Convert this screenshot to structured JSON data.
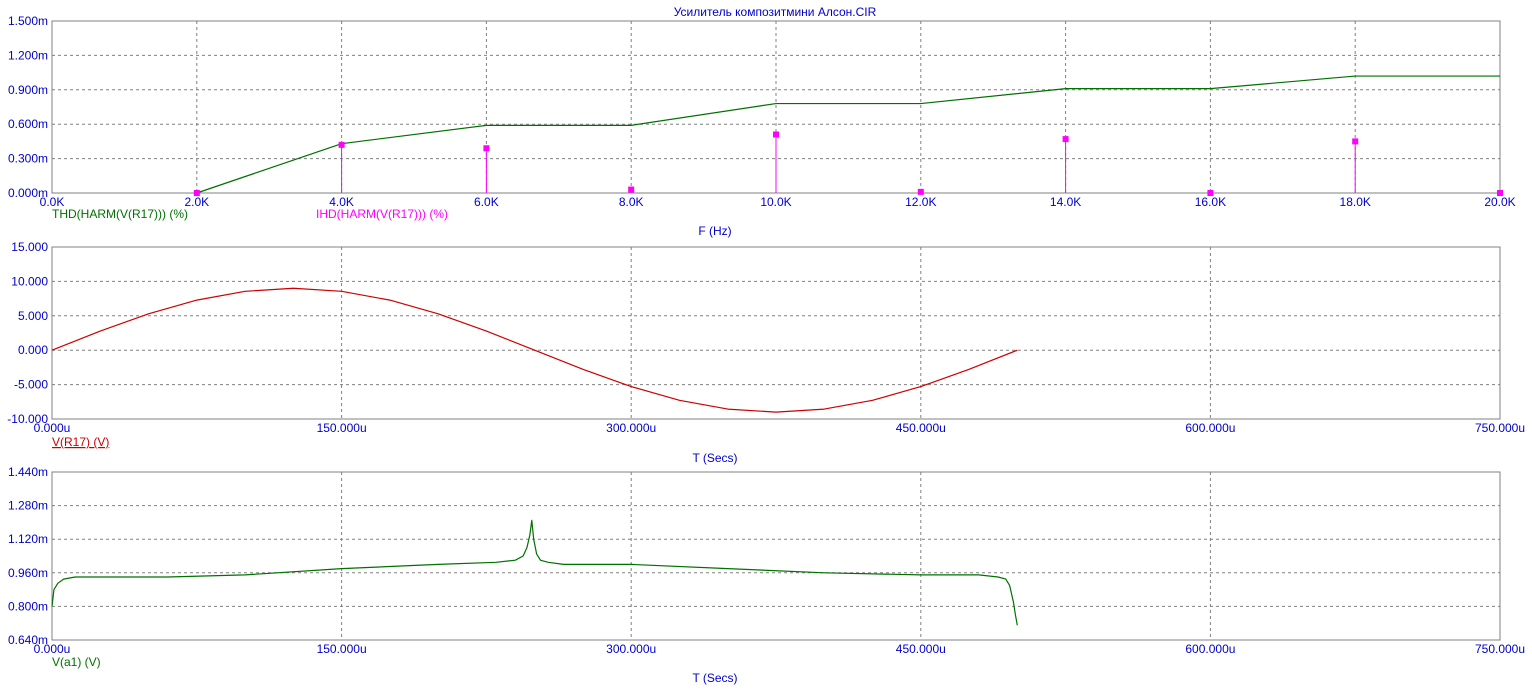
{
  "title": "Усилитель  композитмини Алсон.CIR",
  "colors": {
    "axis_text": "#0000cc",
    "grid": "#808080",
    "frame": "#808080",
    "thd": "#007000",
    "ihd": "#ff00ff",
    "vr17": "#cc0000",
    "va1": "#007000"
  },
  "chart_data": [
    {
      "type": "line",
      "xlabel": "F (Hz)",
      "xlim": [
        0,
        20000
      ],
      "ylim": [
        0,
        1.5
      ],
      "x_ticks": [
        "0.0K",
        "2.0K",
        "4.0K",
        "6.0K",
        "8.0K",
        "10.0K",
        "12.0K",
        "14.0K",
        "16.0K",
        "18.0K",
        "20.0K"
      ],
      "y_ticks": [
        "0.000m",
        "0.300m",
        "0.600m",
        "0.900m",
        "1.200m",
        "1.500m"
      ],
      "grid": true,
      "series": [
        {
          "name": "THD(HARM(V(R17))) (%)",
          "style": "line",
          "x": [
            2000,
            4000,
            6000,
            8000,
            10000,
            12000,
            14000,
            16000,
            18000,
            20000
          ],
          "y": [
            0.0,
            0.43,
            0.59,
            0.59,
            0.78,
            0.78,
            0.91,
            0.91,
            1.02,
            1.02
          ]
        },
        {
          "name": "IHD(HARM(V(R17))) (%)",
          "style": "stem",
          "x": [
            2000,
            4000,
            6000,
            8000,
            10000,
            12000,
            14000,
            16000,
            18000,
            20000
          ],
          "y": [
            0.0,
            0.42,
            0.39,
            0.03,
            0.51,
            0.01,
            0.47,
            0.0,
            0.45,
            0.0
          ]
        }
      ]
    },
    {
      "type": "line",
      "xlabel": "T (Secs)",
      "xlim": [
        0,
        750
      ],
      "ylim": [
        -10,
        15
      ],
      "x_ticks": [
        "0.000u",
        "150.000u",
        "300.000u",
        "450.000u",
        "600.000u",
        "750.000u"
      ],
      "y_ticks": [
        "-10.000",
        "-5.000",
        "0.000",
        "5.000",
        "10.000",
        "15.000"
      ],
      "grid": true,
      "series": [
        {
          "name": "V(R17) (V)",
          "x": [
            0,
            25,
            50,
            75,
            100,
            125,
            150,
            175,
            200,
            225,
            250,
            275,
            300,
            325,
            350,
            375,
            400,
            425,
            450,
            475,
            500
          ],
          "y": [
            0.0,
            2.78,
            5.29,
            7.28,
            8.56,
            9.0,
            8.56,
            7.28,
            5.29,
            2.78,
            0.0,
            -2.78,
            -5.29,
            -7.28,
            -8.56,
            -9.0,
            -8.56,
            -7.28,
            -5.29,
            -2.78,
            0.0
          ]
        }
      ]
    },
    {
      "type": "line",
      "xlabel": "T (Secs)",
      "xlim": [
        0,
        750
      ],
      "ylim": [
        0.64,
        1.44
      ],
      "x_ticks": [
        "0.000u",
        "150.000u",
        "300.000u",
        "450.000u",
        "600.000u",
        "750.000u"
      ],
      "y_ticks": [
        "0.640m",
        "0.800m",
        "0.960m",
        "1.120m",
        "1.280m",
        "1.440m"
      ],
      "grid": true,
      "series": [
        {
          "name": "V(a1) (V)",
          "x": [
            0,
            1,
            3,
            6,
            12,
            30,
            60,
            100,
            150,
            200,
            230,
            240,
            244,
            246,
            247.5,
            248.5,
            249.5,
            251,
            253,
            257,
            265,
            300,
            350,
            400,
            450,
            480,
            490,
            494,
            496,
            498,
            499,
            500
          ],
          "y": [
            0.8,
            0.88,
            0.91,
            0.93,
            0.94,
            0.94,
            0.94,
            0.95,
            0.98,
            1.0,
            1.01,
            1.02,
            1.04,
            1.08,
            1.14,
            1.21,
            1.12,
            1.05,
            1.02,
            1.01,
            1.0,
            1.0,
            0.98,
            0.96,
            0.95,
            0.95,
            0.94,
            0.93,
            0.9,
            0.82,
            0.76,
            0.71
          ]
        }
      ]
    }
  ]
}
